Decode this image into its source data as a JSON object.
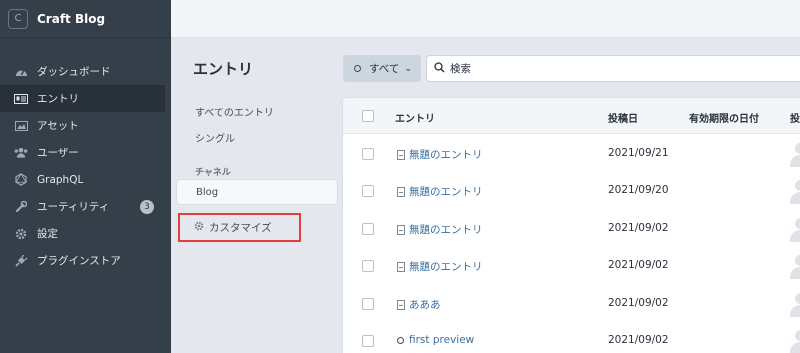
{
  "site": {
    "badge": "C",
    "name": "Craft Blog"
  },
  "nav": [
    {
      "label": "ダッシュボード",
      "icon": "gauge-icon"
    },
    {
      "label": "エントリ",
      "icon": "entries-icon"
    },
    {
      "label": "アセット",
      "icon": "image-icon"
    },
    {
      "label": "ユーザー",
      "icon": "users-icon"
    },
    {
      "label": "GraphQL",
      "icon": "graphql-icon"
    },
    {
      "label": "ユーティリティ",
      "icon": "wrench-icon",
      "badge": "3"
    },
    {
      "label": "設定",
      "icon": "gear-icon"
    },
    {
      "label": "プラグインストア",
      "icon": "plug-icon"
    }
  ],
  "page": {
    "title": "エントリ"
  },
  "sources": {
    "items": [
      "すべてのエントリ",
      "シングル"
    ],
    "heading": "チャネル",
    "channel": "Blog",
    "customize": "カスタマイズ"
  },
  "toolbar": {
    "status": "すべて",
    "search_placeholder": "検索"
  },
  "table": {
    "headers": [
      "エントリ",
      "投稿日",
      "有効期限の日付",
      "投"
    ],
    "rows": [
      {
        "title": "無題のエントリ",
        "date": "2021/09/21",
        "icon": "doc-icon"
      },
      {
        "title": "無題のエントリ",
        "date": "2021/09/20",
        "icon": "doc-icon"
      },
      {
        "title": "無題のエントリ",
        "date": "2021/09/02",
        "icon": "doc-icon"
      },
      {
        "title": "無題のエントリ",
        "date": "2021/09/02",
        "icon": "doc-icon"
      },
      {
        "title": "あああ",
        "date": "2021/09/02",
        "icon": "doc-icon"
      },
      {
        "title": "first preview",
        "date": "2021/09/02",
        "icon": "circle-icon"
      }
    ]
  }
}
